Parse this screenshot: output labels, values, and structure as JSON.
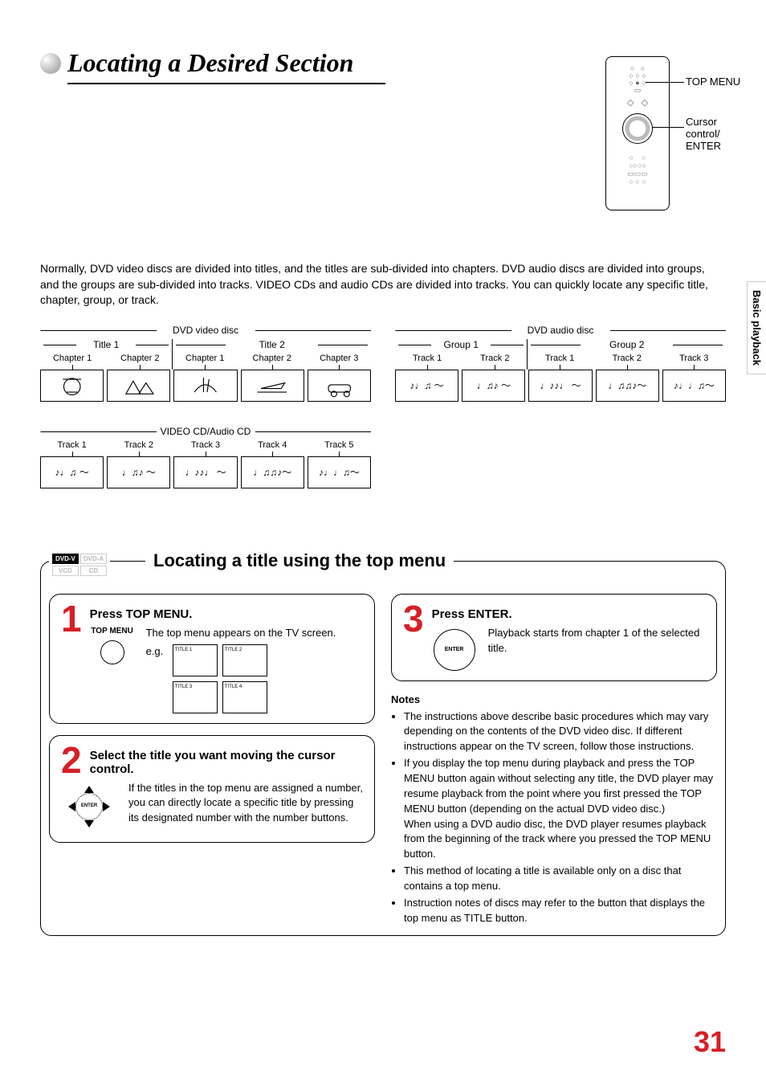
{
  "page_number": "31",
  "side_tab": "Basic playback",
  "main_title": "Locating a Desired Section",
  "remote_labels": {
    "top_menu": "TOP MENU",
    "cursor": "Cursor control/\nENTER"
  },
  "intro": "Normally, DVD video discs are divided into titles, and the titles are sub-divided into chapters. DVD audio discs are divided into groups, and the groups are sub-divided into tracks. VIDEO CDs and audio CDs are divided into tracks. You can quickly locate any specific title, chapter, group, or track.",
  "diagrams": {
    "dvd_video": {
      "label": "DVD video disc",
      "titles": [
        "Title 1",
        "Title 2"
      ],
      "chapters_t1": [
        "Chapter 1",
        "Chapter 2"
      ],
      "chapters_t2": [
        "Chapter 1",
        "Chapter 2",
        "Chapter 3"
      ]
    },
    "dvd_audio": {
      "label": "DVD audio disc",
      "groups": [
        "Group 1",
        "Group 2"
      ],
      "tracks_g1": [
        "Track 1",
        "Track 2"
      ],
      "tracks_g2": [
        "Track 1",
        "Track 2",
        "Track 3"
      ]
    },
    "vcd_cd": {
      "label": "VIDEO CD/Audio CD",
      "tracks": [
        "Track 1",
        "Track 2",
        "Track 3",
        "Track 4",
        "Track 5"
      ]
    }
  },
  "badges": {
    "dvdv": "DVD-V",
    "dvda": "DVD-A",
    "vcd": "VCD",
    "cd": "CD"
  },
  "steps_title": "Locating a title using the top menu",
  "steps": {
    "s1": {
      "num": "1",
      "title": "Press TOP MENU.",
      "icon_label": "TOP MENU",
      "body": "The top menu appears on the TV screen.",
      "eg_label": "e.g.",
      "thumbs": [
        "TITLE 1",
        "TITLE 2",
        "TITLE 3",
        "TITLE 4"
      ]
    },
    "s2": {
      "num": "2",
      "title": "Select the title you want moving the cursor control.",
      "center_label": "ENTER",
      "body": "If the titles in the top menu are assigned a number, you can directly locate a specific title by pressing its designated number with the number buttons."
    },
    "s3": {
      "num": "3",
      "title": "Press ENTER.",
      "center_label": "ENTER",
      "body": "Playback starts from chapter 1 of the selected title."
    }
  },
  "notes_title": "Notes",
  "notes": [
    "The instructions above describe basic procedures which may vary depending on the contents of the DVD video disc. If different instructions appear on the TV screen, follow those instructions.",
    "If you display the top menu during playback and press the TOP MENU button again without selecting any title, the DVD player may resume playback from the point where you first pressed the TOP MENU button (depending on the actual DVD video disc.)\nWhen using a DVD audio disc, the DVD player resumes playback from the beginning of the track where you pressed the TOP MENU button.",
    "This method of locating a title is available only on a disc that contains a top menu.",
    "Instruction notes of discs may refer to the button that displays the top menu as TITLE button."
  ]
}
